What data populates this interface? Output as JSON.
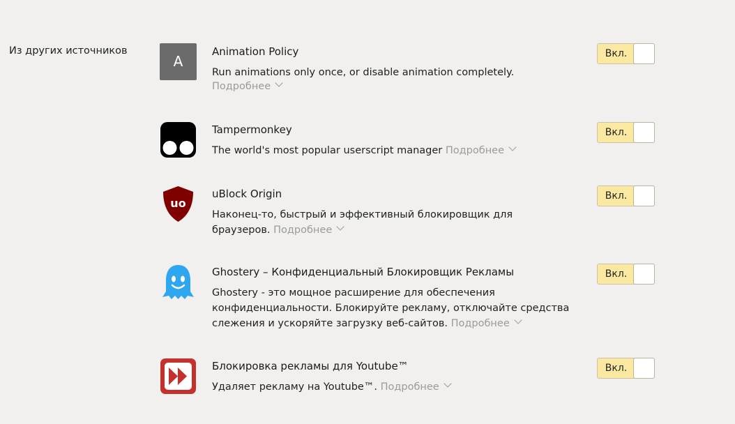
{
  "section": {
    "label": "Из других источников"
  },
  "more_label": "Подробнее",
  "toggle_label": "Вкл.",
  "extensions": [
    {
      "name": "Animation Policy",
      "icon": "letter-a-icon",
      "icon_letter": "A",
      "desc_lines": [
        "Run animations only once, or disable animation completely."
      ],
      "more_on_new_line": true,
      "enabled": true
    },
    {
      "name": "Tampermonkey",
      "icon": "tampermonkey-icon",
      "desc_lines": [
        "The world's most popular userscript manager"
      ],
      "more_on_new_line": false,
      "enabled": true
    },
    {
      "name": "uBlock Origin",
      "icon": "ublock-shield-icon",
      "desc_lines": [
        "Наконец-то, быстрый и эффективный блокировщик для",
        "браузеров."
      ],
      "more_on_new_line": false,
      "enabled": true
    },
    {
      "name": "Ghostery – Конфиденциальный Блокировщик Рекламы",
      "icon": "ghost-icon",
      "desc_lines": [
        "Ghostery - это мощное расширение для обеспечения",
        "конфиденциальности. Блокируйте рекламу, отключайте средства",
        "слежения и ускоряйте загрузку веб-сайтов."
      ],
      "more_on_new_line": false,
      "enabled": true
    },
    {
      "name": "Блокировка рекламы для Youtube™",
      "icon": "youtube-adblock-icon",
      "desc_lines": [
        "Удаляет рекламу на Youtube™."
      ],
      "more_on_new_line": false,
      "enabled": true
    }
  ],
  "colors": {
    "background": "#f1f0ef",
    "toggle_on": "#fbe9a1",
    "ublock_red": "#800000",
    "ghostery_blue": "#2ea7f0",
    "youtube_red": "#c4302b",
    "link_gray": "#9a9a9a"
  }
}
